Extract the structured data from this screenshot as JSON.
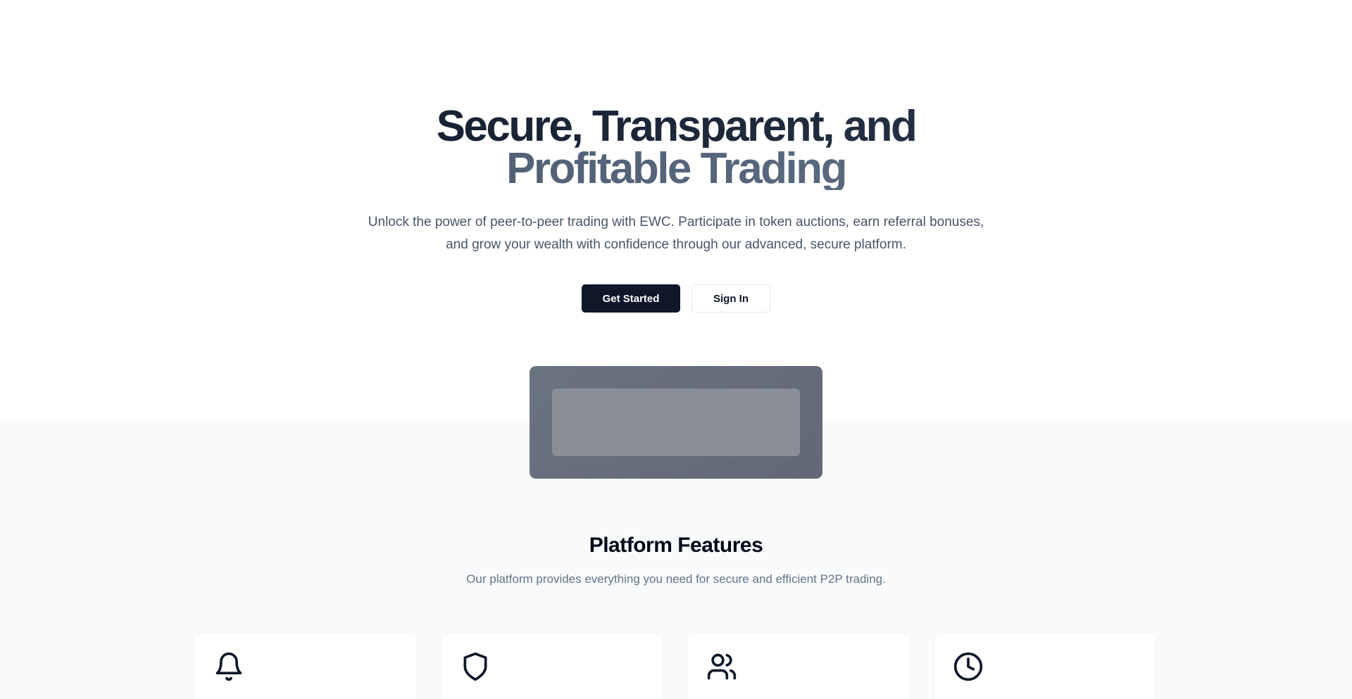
{
  "hero": {
    "title_line1": "Secure, Transparent, and",
    "title_line2": "Profitable Trading",
    "subtitle_line1": "Unlock the power of peer-to-peer trading with EWC. Participate in token auctions, earn referral bonuses,",
    "subtitle_line2": "and grow your wealth with confidence through our advanced, secure platform.",
    "primary_button": "Get Started",
    "secondary_button": "Sign In"
  },
  "features": {
    "title": "Platform Features",
    "subtitle": "Our platform provides everything you need for secure and efficient P2P trading.",
    "cards": [
      {
        "icon": "bell-icon"
      },
      {
        "icon": "shield-icon"
      },
      {
        "icon": "users-icon"
      },
      {
        "icon": "clock-icon"
      }
    ]
  },
  "colors": {
    "primary": "#0f172a",
    "muted_text": "#64748b",
    "section_bg": "#f8fafc"
  }
}
